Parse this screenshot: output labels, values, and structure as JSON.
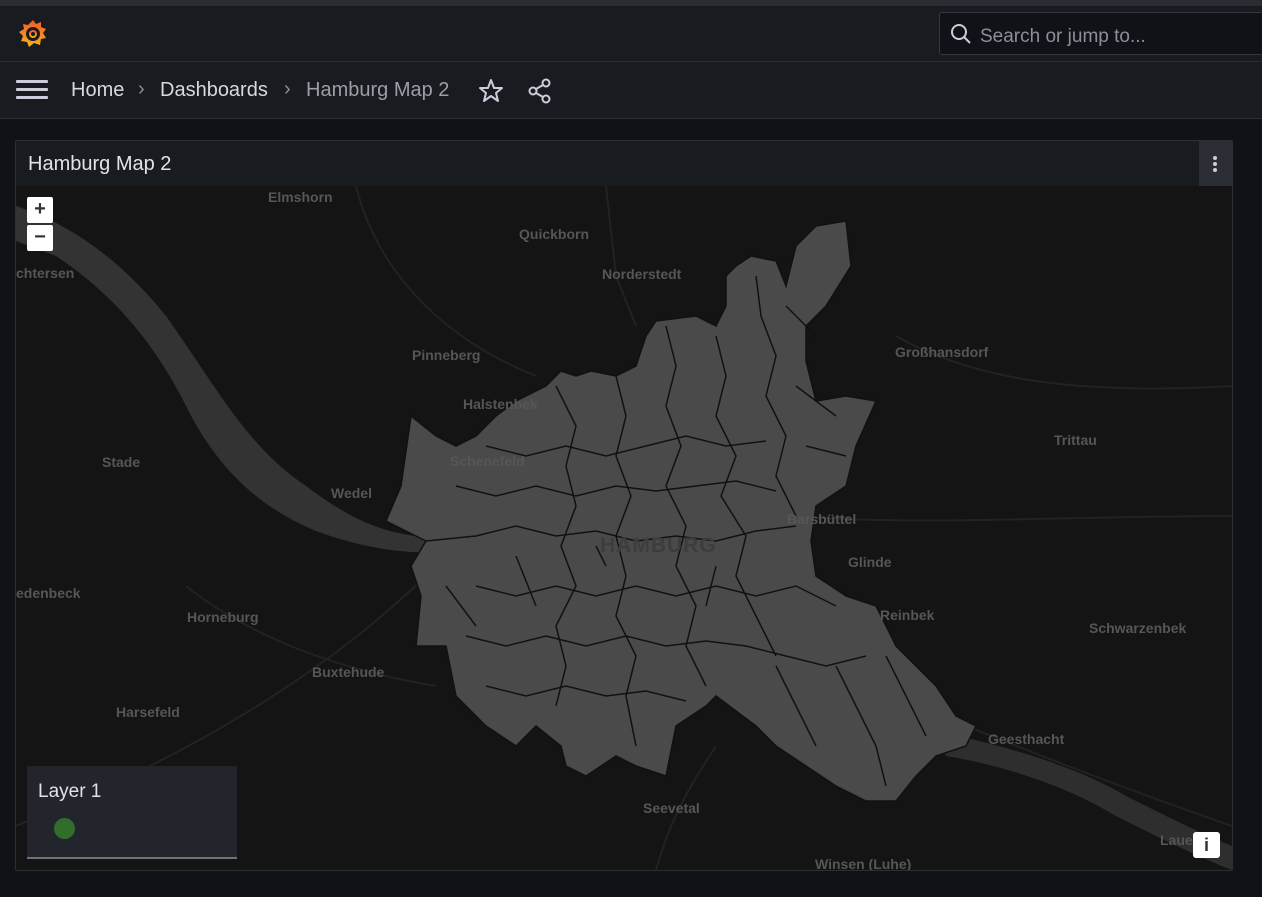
{
  "topbar": {
    "logo": "grafana-logo-icon",
    "search_placeholder": "Search or jump to..."
  },
  "breadcrumb": {
    "home": "Home",
    "dashboards": "Dashboards",
    "current": "Hamburg Map 2",
    "separator": "›"
  },
  "panel": {
    "title": "Hamburg Map 2",
    "zoom_in": "+",
    "zoom_out": "−",
    "info": "i",
    "legend": {
      "title": "Layer 1",
      "color": "#37872d"
    },
    "map": {
      "city_label": "HAMBURG",
      "places": {
        "elmshorn": "Elmshorn",
        "quickborn": "Quickborn",
        "chtersen": "chtersen",
        "norderstedt": "Norderstedt",
        "pinneberg": "Pinneberg",
        "grosshansdorf": "Großhansdorf",
        "halstenbek": "Halstenbek",
        "stade": "Stade",
        "schenefeld": "Schenefeld",
        "trittau": "Trittau",
        "wedel": "Wedel",
        "barsbuettel": "Barsbüttel",
        "glinde": "Glinde",
        "edenbeck": "edenbeck",
        "horneburg": "Horneburg",
        "reinbek": "Reinbek",
        "schwarzenbek": "Schwarzenbek",
        "buxtehude": "Buxtehude",
        "harsefeld": "Harsefeld",
        "geesthacht": "Geesthacht",
        "seevetal": "Seevetal",
        "winsen": "Winsen (Luhe)",
        "lauen": "Lauen"
      },
      "colors": {
        "background": "#141414",
        "region_fill": "#4a4a4a",
        "region_border": "#111111",
        "river": "#333333"
      }
    }
  }
}
